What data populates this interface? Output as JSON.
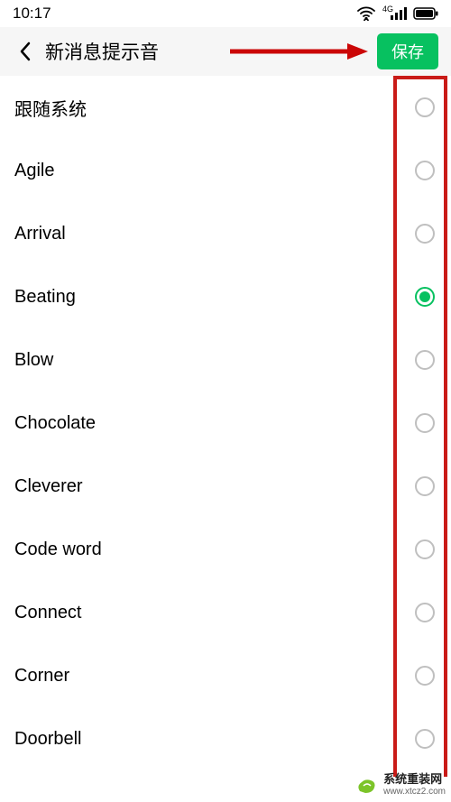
{
  "status": {
    "time": "10:17",
    "network_label": "4G"
  },
  "header": {
    "title": "新消息提示音",
    "save_label": "保存"
  },
  "ringtones": {
    "selected_index": 3,
    "items": [
      {
        "label": "跟随系统"
      },
      {
        "label": "Agile"
      },
      {
        "label": "Arrival"
      },
      {
        "label": "Beating"
      },
      {
        "label": "Blow"
      },
      {
        "label": "Chocolate"
      },
      {
        "label": "Cleverer"
      },
      {
        "label": "Code word"
      },
      {
        "label": "Connect"
      },
      {
        "label": "Corner"
      },
      {
        "label": "Doorbell"
      }
    ]
  },
  "watermark": {
    "line1": "系统重装网",
    "line2": "www.xtcz2.com"
  },
  "annotation": {
    "highlight_color": "#c91b18",
    "arrow_color": "#cb0606"
  }
}
